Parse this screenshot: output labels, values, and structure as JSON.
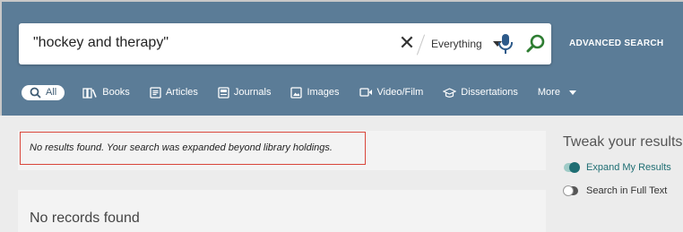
{
  "search": {
    "query": "\"hockey and therapy\"",
    "scope": "Everything",
    "advanced_label": "ADVANCED SEARCH"
  },
  "tabs": [
    {
      "label": "All",
      "icon": "search-icon",
      "active": true
    },
    {
      "label": "Books",
      "icon": "books-icon"
    },
    {
      "label": "Articles",
      "icon": "articles-icon"
    },
    {
      "label": "Journals",
      "icon": "journals-icon"
    },
    {
      "label": "Images",
      "icon": "images-icon"
    },
    {
      "label": "Video/Film",
      "icon": "video-icon"
    },
    {
      "label": "Dissertations",
      "icon": "graduation-cap-icon"
    },
    {
      "label": "More",
      "icon": "chevron-down-icon"
    }
  ],
  "notice": "No results found. Your search was expanded beyond library holdings.",
  "records": "No records found",
  "tweak": {
    "title": "Tweak your results",
    "options": [
      {
        "label": "Expand My Results",
        "on": true
      },
      {
        "label": "Search in Full Text",
        "on": false
      }
    ]
  },
  "colors": {
    "header": "#5b7c97",
    "accent": "#1f6e73",
    "search_icon": "#2e7d32",
    "mic_icon": "#2d5a8a",
    "notice_border": "#d9463b"
  }
}
